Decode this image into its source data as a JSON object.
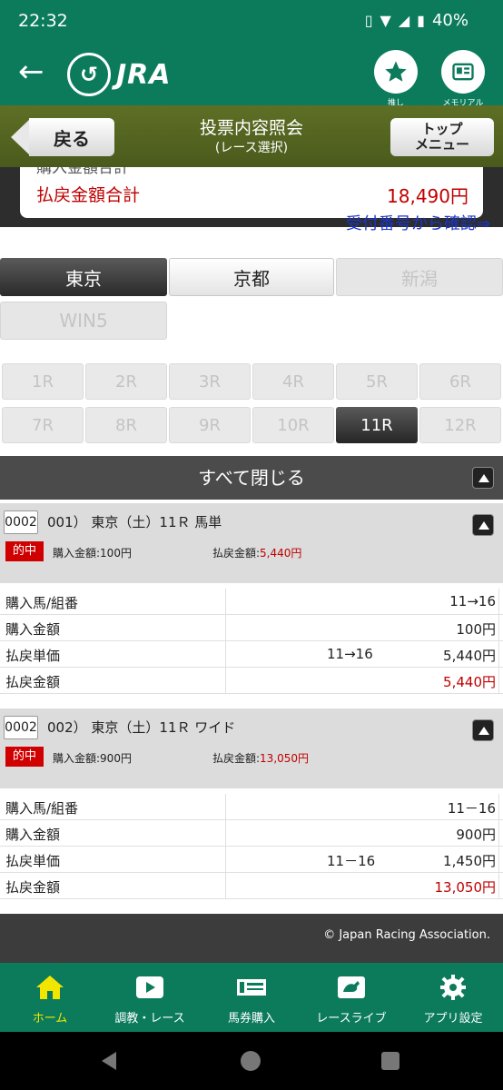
{
  "status_bar": {
    "time": "22:32",
    "battery": "40%"
  },
  "app_bar": {
    "logo_text": "JRA",
    "fav_label": "推し",
    "memorial_label": "メモリアル"
  },
  "header": {
    "back_label": "戻る",
    "title": "投票内容照会",
    "subtitle": "(レース選択)",
    "top_menu_label": "トップ\nメニュー"
  },
  "summary": {
    "clipped_label": "購入金額合計",
    "refund_label": "払戻金額合計",
    "refund_value": "18,490円"
  },
  "confirm_link": "受付番号から確認⇒",
  "venues": [
    {
      "label": "東京",
      "state": "active"
    },
    {
      "label": "京都",
      "state": "normal"
    },
    {
      "label": "新潟",
      "state": "disabled"
    },
    {
      "label": "WIN5",
      "state": "disabled"
    }
  ],
  "races": [
    "1R",
    "2R",
    "3R",
    "4R",
    "5R",
    "6R",
    "7R",
    "8R",
    "9R",
    "10R",
    "11R",
    "12R"
  ],
  "selected_race": "11R",
  "close_all_label": "すべて閉じる",
  "bets": [
    {
      "number": "0002",
      "desc": "001） 東京（土）11Ｒ 馬単",
      "hit_label": "的中",
      "buy_text": "購入金額:100円",
      "pay_label": "払戻金額:",
      "pay_value": "5,440円",
      "rows": [
        {
          "label": "購入馬/組番",
          "mid": "",
          "value": "11→16",
          "red": false
        },
        {
          "label": "購入金額",
          "mid": "",
          "value": "100円",
          "red": false
        },
        {
          "label": "払戻単価",
          "mid": "11→16",
          "value": "5,440円",
          "red": false
        },
        {
          "label": "払戻金額",
          "mid": "",
          "value": "5,440円",
          "red": true
        }
      ]
    },
    {
      "number": "0002",
      "desc": "002） 東京（土）11Ｒ ワイド",
      "hit_label": "的中",
      "buy_text": "購入金額:900円",
      "pay_label": "払戻金額:",
      "pay_value": "13,050円",
      "rows": [
        {
          "label": "購入馬/組番",
          "mid": "",
          "value": "11－16",
          "red": false
        },
        {
          "label": "購入金額",
          "mid": "",
          "value": "900円",
          "red": false
        },
        {
          "label": "払戻単価",
          "mid": "11－16",
          "value": "1,450円",
          "red": false
        },
        {
          "label": "払戻金額",
          "mid": "",
          "value": "13,050円",
          "red": true
        }
      ]
    }
  ],
  "footer_copyright": "© Japan Racing Association.",
  "bottom_nav": [
    {
      "label": "ホーム",
      "icon": "home-icon",
      "active": true
    },
    {
      "label": "調教・レース",
      "icon": "play-icon",
      "active": false
    },
    {
      "label": "馬券購入",
      "icon": "ticket-icon",
      "active": false
    },
    {
      "label": "レースライブ",
      "icon": "race-live-icon",
      "active": false
    },
    {
      "label": "アプリ設定",
      "icon": "gear-icon",
      "active": false
    }
  ],
  "colors": {
    "brand_green": "#0b7b5c",
    "olive": "#5e6f25",
    "payout_red": "#c00000",
    "link_blue": "#1a35c8"
  }
}
